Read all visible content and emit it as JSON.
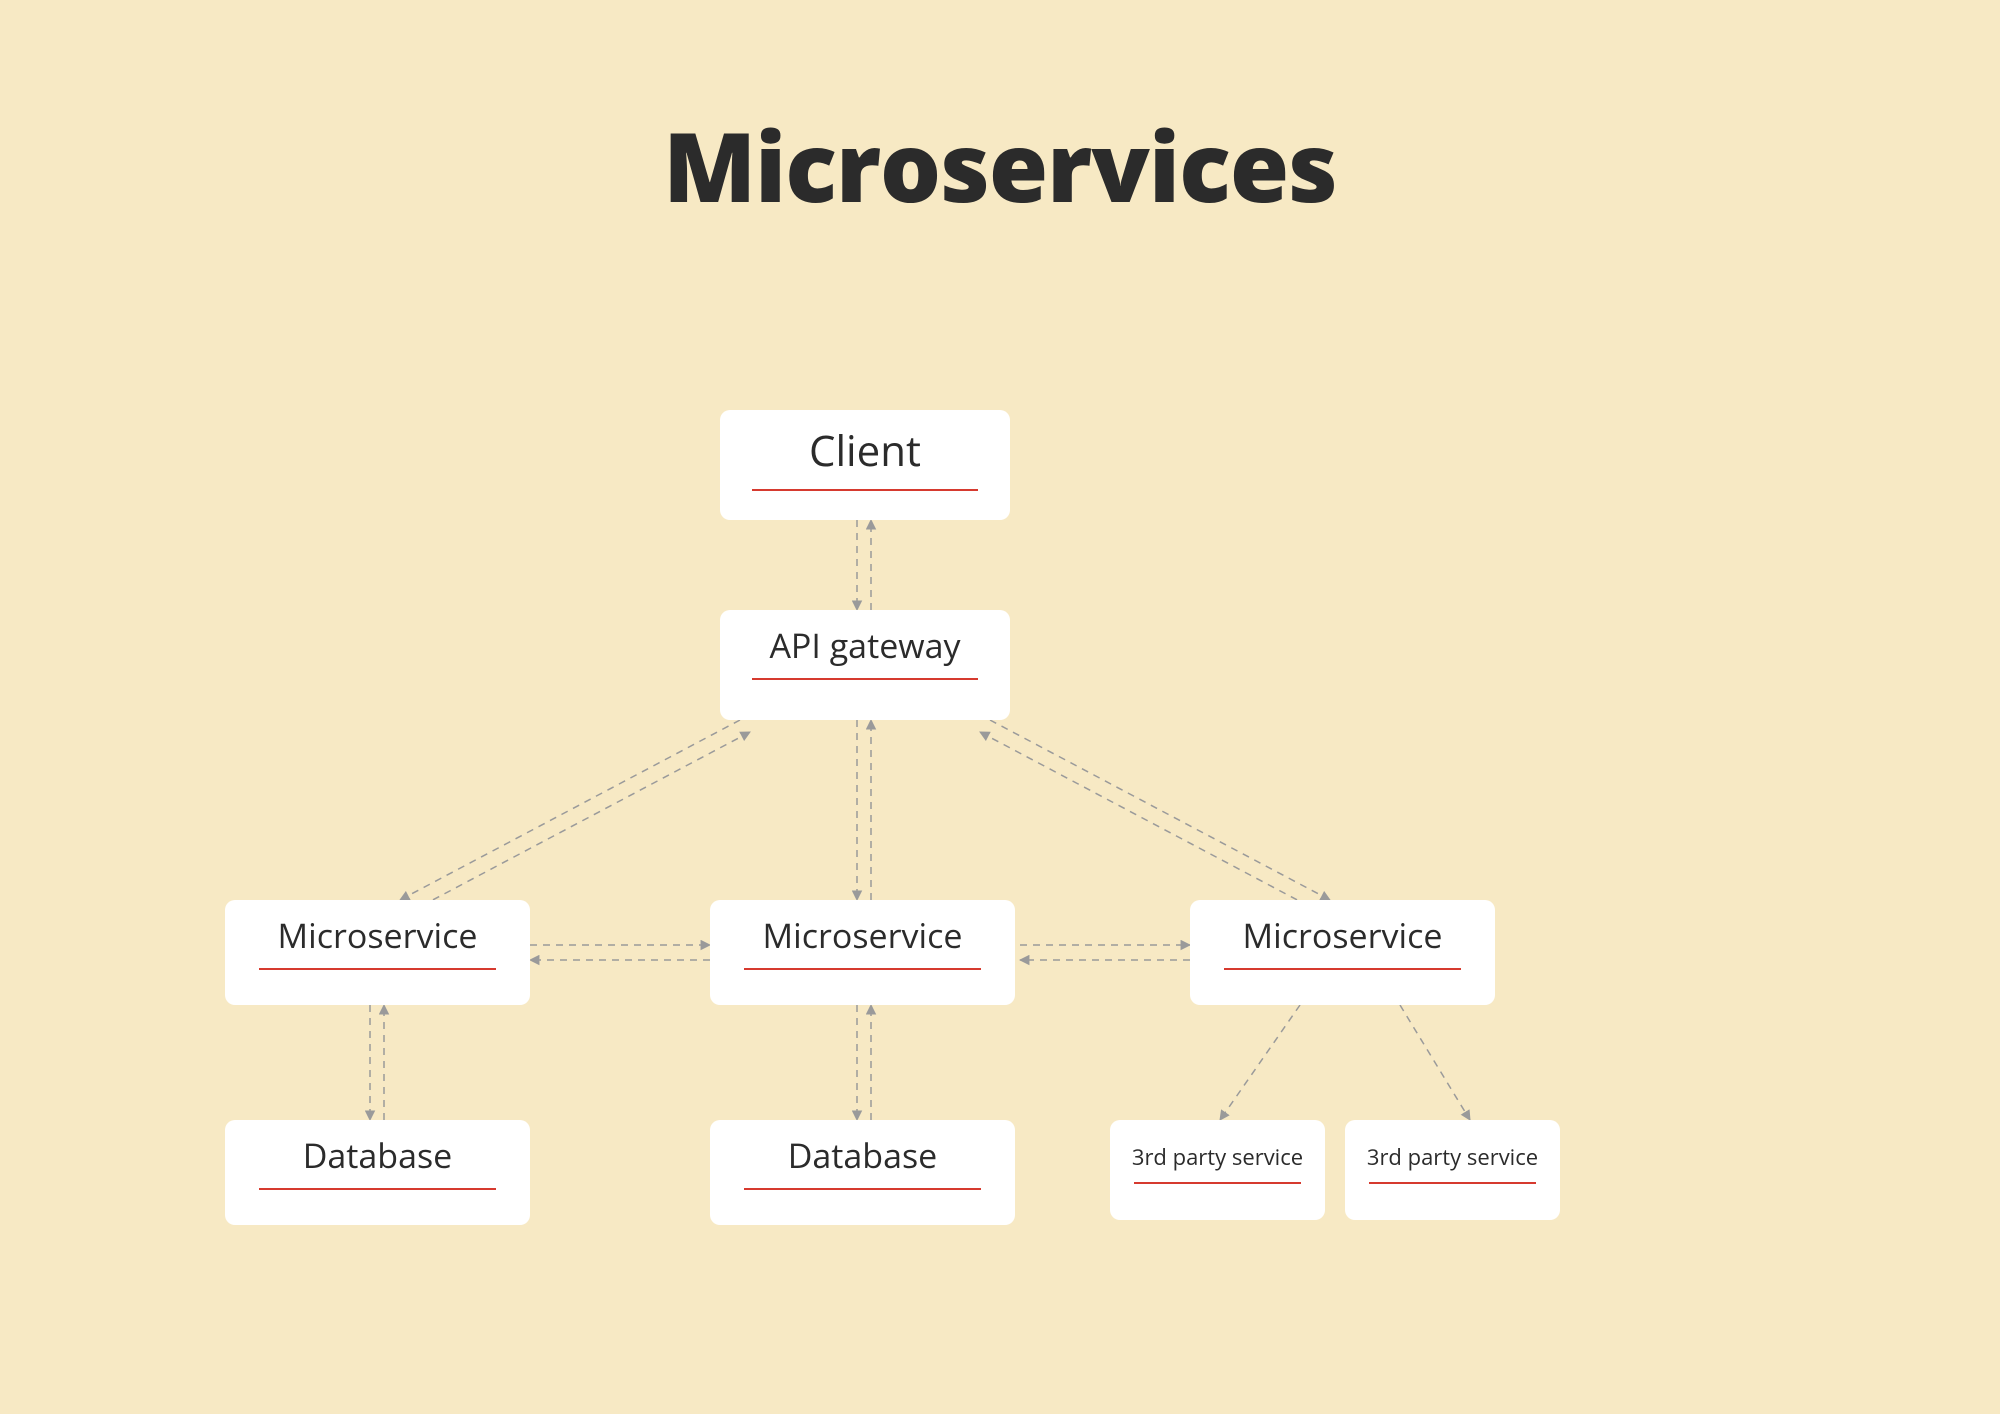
{
  "title": "Microservices",
  "nodes": {
    "client": "Client",
    "api_gateway": "API gateway",
    "microservice1": "Microservice",
    "microservice2": "Microservice",
    "microservice3": "Microservice",
    "database1": "Database",
    "database2": "Database",
    "third_party1": "3rd party service",
    "third_party2": "3rd party service"
  },
  "colors": {
    "background": "#f7e9c4",
    "node_bg": "#ffffff",
    "text": "#2b2b2b",
    "underline": "#d63a2f",
    "connector": "#9a9a9a"
  },
  "diagram": {
    "type": "architecture",
    "description": "Microservices architecture. A Client communicates bidirectionally with an API gateway. The API gateway fans out bidirectionally to three Microservice nodes. Microservice 1 and Microservice 2 each connect bidirectionally with their own Database. Microservice 2 also connects horizontally (bidirectionally) to Microservice 1 and Microservice 3. Microservice 3 connects down to two 3rd party service nodes.",
    "edges": [
      {
        "from": "client",
        "to": "api_gateway",
        "style": "dashed",
        "bidirectional": true
      },
      {
        "from": "api_gateway",
        "to": "microservice1",
        "style": "dashed",
        "bidirectional": true
      },
      {
        "from": "api_gateway",
        "to": "microservice2",
        "style": "dashed",
        "bidirectional": true
      },
      {
        "from": "api_gateway",
        "to": "microservice3",
        "style": "dashed",
        "bidirectional": true
      },
      {
        "from": "microservice1",
        "to": "microservice2",
        "style": "dashed",
        "bidirectional": true
      },
      {
        "from": "microservice2",
        "to": "microservice3",
        "style": "dashed",
        "bidirectional": true
      },
      {
        "from": "microservice1",
        "to": "database1",
        "style": "dashed",
        "bidirectional": true
      },
      {
        "from": "microservice2",
        "to": "database2",
        "style": "dashed",
        "bidirectional": true
      },
      {
        "from": "microservice3",
        "to": "third_party1",
        "style": "dashed",
        "bidirectional": false
      },
      {
        "from": "microservice3",
        "to": "third_party2",
        "style": "dashed",
        "bidirectional": false
      }
    ]
  }
}
